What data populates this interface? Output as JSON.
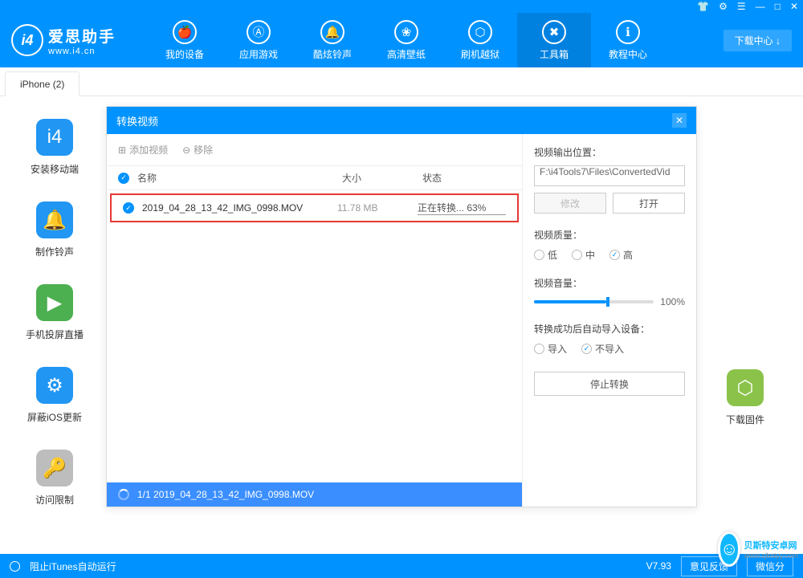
{
  "titlebar": {
    "icons": [
      "👕",
      "⚙",
      "☰",
      "—",
      "□",
      "✕"
    ]
  },
  "header": {
    "logo_cn": "爱思助手",
    "logo_en": "www.i4.cn",
    "nav": [
      {
        "label": "我的设备",
        "icon": "🍎"
      },
      {
        "label": "应用游戏",
        "icon": "Ⓐ"
      },
      {
        "label": "酷炫铃声",
        "icon": "🔔"
      },
      {
        "label": "高清壁纸",
        "icon": "❀"
      },
      {
        "label": "刷机越狱",
        "icon": "⬡"
      },
      {
        "label": "工具箱",
        "icon": "✖"
      },
      {
        "label": "教程中心",
        "icon": "ℹ"
      }
    ],
    "active_index": 5,
    "dl_center": "下载中心 ↓"
  },
  "tab": "iPhone (2)",
  "sidebar": [
    {
      "label": "安装移动端",
      "color": "#2196f3",
      "icon": "i4"
    },
    {
      "label": "制作铃声",
      "color": "#2196f3",
      "icon": "🔔"
    },
    {
      "label": "手机投屏直播",
      "color": "#4caf50",
      "icon": "▶"
    },
    {
      "label": "屏蔽iOS更新",
      "color": "#2196f3",
      "icon": "⚙"
    },
    {
      "label": "访问限制",
      "color": "#bdbdbd",
      "icon": "🔑"
    }
  ],
  "right_sidebar": {
    "label": "下载固件",
    "color": "#8bc34a",
    "icon": "⬡"
  },
  "modal": {
    "title": "转换视频",
    "add": "添加视频",
    "remove": "移除",
    "col_name": "名称",
    "col_size": "大小",
    "col_status": "状态",
    "row": {
      "name": "2019_04_28_13_42_IMG_0998.MOV",
      "size": "11.78 MB",
      "status": "正在转换... 63%"
    },
    "progress": "1/1  2019_04_28_13_42_IMG_0998.MOV",
    "output_label": "视频输出位置：",
    "output_path": "F:\\i4Tools7\\Files\\ConvertedVid",
    "modify": "修改",
    "open": "打开",
    "quality_label": "视频质量：",
    "quality_opts": [
      "低",
      "中",
      "高"
    ],
    "quality_sel": 2,
    "volume_label": "视频音量：",
    "volume_val": "100%",
    "import_label": "转换成功后自动导入设备：",
    "import_opts": [
      "导入",
      "不导入"
    ],
    "import_sel": 1,
    "stop": "停止转换"
  },
  "footer": {
    "itunes": "阻止iTunes自动运行",
    "version": "V7.93",
    "feedback": "意见反馈",
    "share": "微信分"
  },
  "watermark": {
    "name": "贝斯特安卓网",
    "url": "www.zjbstyy.com"
  }
}
